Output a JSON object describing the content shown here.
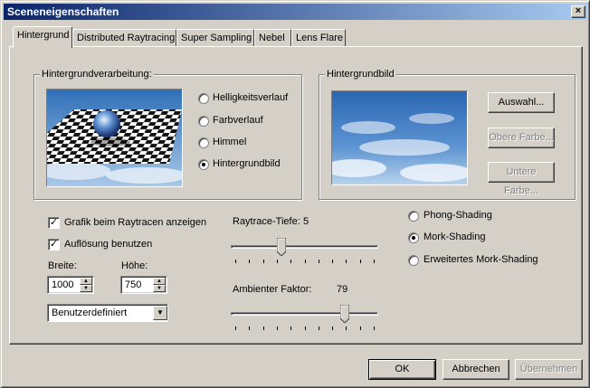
{
  "window": {
    "title": "Sceneneigenschaften",
    "close_glyph": "×"
  },
  "tabs": [
    {
      "label": "Hintergrund",
      "active": true
    },
    {
      "label": "Distributed Raytracing",
      "active": false
    },
    {
      "label": "Super Sampling",
      "active": false
    },
    {
      "label": "Nebel",
      "active": false
    },
    {
      "label": "Lens Flare",
      "active": false
    }
  ],
  "background_processing": {
    "label": "Hintergrundverarbeitung:",
    "options": [
      "Helligkeitsverlauf",
      "Farbverlauf",
      "Himmel",
      "Hintergrundbild"
    ],
    "selected": "Hintergrundbild"
  },
  "background_image": {
    "label": "Hintergrundbild",
    "buttons": {
      "select": "Auswahl...",
      "upper_color": "Obere Farbe...",
      "lower_color": "Untere Farbe..."
    }
  },
  "options": {
    "show_graphic": {
      "label": "Grafik beim Raytracen anzeigen",
      "checked": true
    },
    "use_resolution": {
      "label": "Auflösung benutzen",
      "checked": true
    }
  },
  "resolution": {
    "width_label": "Breite:",
    "width_value": "1000",
    "height_label": "Höhe:",
    "height_value": "750",
    "preset_selected": "Benutzerdefiniert"
  },
  "raytrace_depth": {
    "label": "Raytrace-Tiefe:",
    "value": 5,
    "min": 0,
    "max": 15
  },
  "ambient_factor": {
    "label": "Ambienter Faktor:",
    "value": 79,
    "min": 0,
    "max": 100
  },
  "shading": {
    "options": [
      "Phong-Shading",
      "Mork-Shading",
      "Erweitertes Mork-Shading"
    ],
    "selected": "Mork-Shading"
  },
  "footer": {
    "ok": "OK",
    "cancel": "Abbrechen",
    "apply": "Übernehmen"
  },
  "colors": {
    "titlebar_start": "#0a246a",
    "titlebar_end": "#a6caf0",
    "face": "#d4d0c8",
    "sky": "#3f7fc6"
  }
}
